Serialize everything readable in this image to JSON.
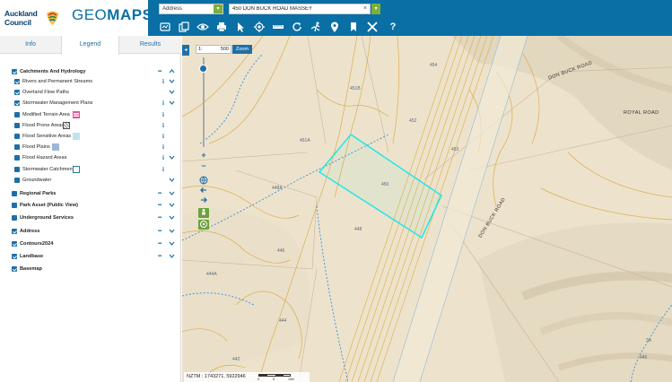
{
  "header": {
    "council_line1": "Auckland",
    "council_line2": "Council",
    "app_title_light": "GEO",
    "app_title_bold": "MAPS",
    "search_type": "Address",
    "search_value": "450 DON BUCK ROAD MASSEY",
    "clear_symbol": "×",
    "go_symbol": "▾",
    "dropdown_symbol": "▾"
  },
  "toolbar": {
    "tools": [
      "map-layers-icon",
      "copy-icon",
      "eye-icon",
      "print-icon",
      "cursor-icon",
      "locate-icon",
      "measure-icon",
      "refresh-icon",
      "run-icon",
      "pin-icon",
      "bookmark-icon",
      "tools-icon",
      "help-icon"
    ],
    "help_label": "?"
  },
  "panel": {
    "tabs": [
      "Info",
      "Legend",
      "Results"
    ],
    "active_tab": "Legend",
    "layers": [
      {
        "label": "Catchments And Hydrology",
        "group": true,
        "checked": true,
        "controls": "dots-up"
      },
      {
        "label": "Rivers and Permanent Streams",
        "group": false,
        "checked": true,
        "controls": "info-down"
      },
      {
        "label": "Overland Flow Paths",
        "group": false,
        "checked": true,
        "controls": "down"
      },
      {
        "label": "Stormwater Management Plans",
        "group": false,
        "checked": true,
        "controls": "info-down"
      },
      {
        "label": "Modified Terrain Area",
        "group": false,
        "checked": false,
        "controls": "info",
        "swatch": "#e0559a"
      },
      {
        "label": "Flood Prone Areas",
        "group": false,
        "checked": false,
        "controls": "info",
        "swatch": "#555555"
      },
      {
        "label": "Flood Sensitive Areas",
        "group": false,
        "checked": false,
        "controls": "info",
        "swatch": "#bfe3ef"
      },
      {
        "label": "Flood Plains",
        "group": false,
        "checked": false,
        "controls": "info",
        "swatch": "#9db6d6"
      },
      {
        "label": "Flood Hazard Areas",
        "group": false,
        "checked": false,
        "controls": "info-down"
      },
      {
        "label": "Stormwater Catchments",
        "group": false,
        "checked": false,
        "controls": "info",
        "swatch": "#2e7d8a"
      },
      {
        "label": "Groundwater",
        "group": false,
        "checked": false,
        "controls": "down"
      },
      {
        "label": "Regional Parks",
        "group": true,
        "checked": false,
        "controls": "dots-down"
      },
      {
        "label": "Park Asset (Public View)",
        "group": true,
        "checked": false,
        "controls": "dots-down"
      },
      {
        "label": "Underground Services",
        "group": true,
        "checked": false,
        "controls": "dots-down"
      },
      {
        "label": "Address",
        "group": true,
        "checked": true,
        "controls": "dots-down"
      },
      {
        "label": "Contours2024",
        "group": true,
        "checked": true,
        "controls": "dots-down"
      },
      {
        "label": "Landbase",
        "group": true,
        "checked": true,
        "controls": "dots-down"
      },
      {
        "label": "Basemap",
        "group": true,
        "checked": true,
        "controls": "none"
      }
    ]
  },
  "map": {
    "collapse_symbol": "◂",
    "scale_prefix": "1:",
    "scale_value": "500",
    "zoom_button": "Zoom",
    "zoom_in": "+",
    "zoom_out": "−",
    "coords": "NZTM : 1743271, 5922946",
    "scalebar_ticks": [
      "0",
      "5",
      "10m"
    ],
    "road_labels": [
      "DON BUCK ROAD",
      "ROYAL ROAD",
      "DON BUCK ROAD"
    ],
    "address_labels": [
      "454",
      "451B",
      "452",
      "451A",
      "453",
      "450",
      "448A",
      "448",
      "446",
      "444A",
      "444",
      "442",
      "3A",
      "445"
    ]
  },
  "colors": {
    "header_blue": "#0a6fa5",
    "accent_green": "#7bb03a",
    "link_blue": "#1e6fa8",
    "parcel_cyan": "#23e6e6",
    "contour_orange": "#d9a23c",
    "stream_blue": "#3a8cd6"
  }
}
